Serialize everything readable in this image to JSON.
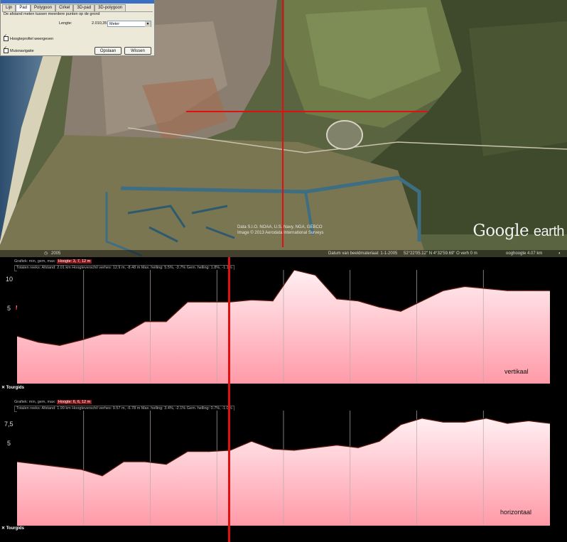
{
  "ruler_dialog": {
    "tabs": [
      "Lijn",
      "Pad",
      "Polygoon",
      "Cirkel",
      "3D-pad",
      "3D-polygoon"
    ],
    "active_tab": "Pad",
    "description": "De afstand meten tussen meerdere punten op de grond",
    "length_label": "Lengte:",
    "length_value": "2.010,35",
    "unit": "Meter",
    "show_profile_label": "Hoogteprofiel weergeven",
    "mouse_nav_label": "Muisnavigatie",
    "save_label": "Opslaan",
    "clear_label": "Wissen"
  },
  "map": {
    "attribution_1": "Data S.I.O. NOAA, U.S. Navy, NGA, GEBCO",
    "attribution_2": "Image © 2013 Aerodata International Surveys",
    "logo_google": "Google",
    "logo_earth": "earth",
    "year": "2005",
    "status_date": "Datum van beeldmateriaal: 1-1-2005",
    "status_coords": "52°22'05.12\" N    4°32'59.69\" O  verh    0 m",
    "status_eye": "ooghoogte   4.07 km"
  },
  "profile_top": {
    "header": "Grafiek: min, gem, max:",
    "highlight": "Hoogte: 3, 7, 12 m",
    "stats_label": "Totalen reeks:",
    "distance": "Afstand: 2.01 km",
    "elev_gain": "Hoogteverschil verhes: 12.9 m, -8.48 m",
    "max_slope": "Max. helling: 5.5%, -3.7%",
    "avg_slope": "Gem. helling: 1.8%, -1.1%",
    "label": "vertikaal",
    "tourgids": "Tourgids",
    "marker": "5 m",
    "ytick_upper": "10",
    "ytick_lower": "5"
  },
  "profile_bottom": {
    "header": "Grafiek: min, gem, max:",
    "highlight": "Hoogte: 6, 6, 12 m",
    "stats_label": "Totalen reeks:",
    "distance": "Afstand: 1.99 km",
    "elev_gain": "Hoogteverschil verhes: 9.57 m, -6.78 m",
    "max_slope": "Max. helling: 3.4%, -2.1%",
    "avg_slope": "Gem. helling: 0.7%, -1.0%",
    "label": "horizontaal",
    "tourgids": "Tourgids",
    "ytick_upper": "7,5",
    "ytick_lower": "5"
  },
  "colors": {
    "accent_red": "#e01010",
    "fill_top": "#ffeff2",
    "fill_bottom": "#ff9aa8",
    "line": "#5a1a10"
  },
  "chart_data": [
    {
      "type": "area",
      "label": "vertikaal",
      "x": [
        0.0,
        0.04,
        0.08,
        0.12,
        0.16,
        0.2,
        0.24,
        0.28,
        0.32,
        0.36,
        0.4,
        0.44,
        0.48,
        0.52,
        0.56,
        0.6,
        0.64,
        0.68,
        0.72,
        0.76,
        0.8,
        0.84,
        0.88,
        0.92,
        0.96,
        1.0
      ],
      "y": [
        4.6,
        4.0,
        3.7,
        4.2,
        4.8,
        4.8,
        6.0,
        6.0,
        7.9,
        7.9,
        7.9,
        8.1,
        8.0,
        11.0,
        10.5,
        8.2,
        8.0,
        7.4,
        7.0,
        8.0,
        9.0,
        9.4,
        9.2,
        9.0,
        9.0,
        9.0
      ],
      "ylim": [
        0,
        11
      ]
    },
    {
      "type": "area",
      "label": "horizontaal",
      "x": [
        0.0,
        0.04,
        0.08,
        0.12,
        0.16,
        0.2,
        0.24,
        0.28,
        0.32,
        0.36,
        0.4,
        0.44,
        0.48,
        0.52,
        0.56,
        0.6,
        0.64,
        0.68,
        0.72,
        0.76,
        0.8,
        0.84,
        0.88,
        0.92,
        0.96,
        1.0
      ],
      "y": [
        5.0,
        4.8,
        4.6,
        4.4,
        3.9,
        5.0,
        5.0,
        4.8,
        5.8,
        5.8,
        5.9,
        6.6,
        6.0,
        5.9,
        6.1,
        6.3,
        6.1,
        6.6,
        7.9,
        8.4,
        8.1,
        8.1,
        8.4,
        8.0,
        8.2,
        8.0
      ],
      "ylim": [
        0,
        9
      ]
    }
  ]
}
